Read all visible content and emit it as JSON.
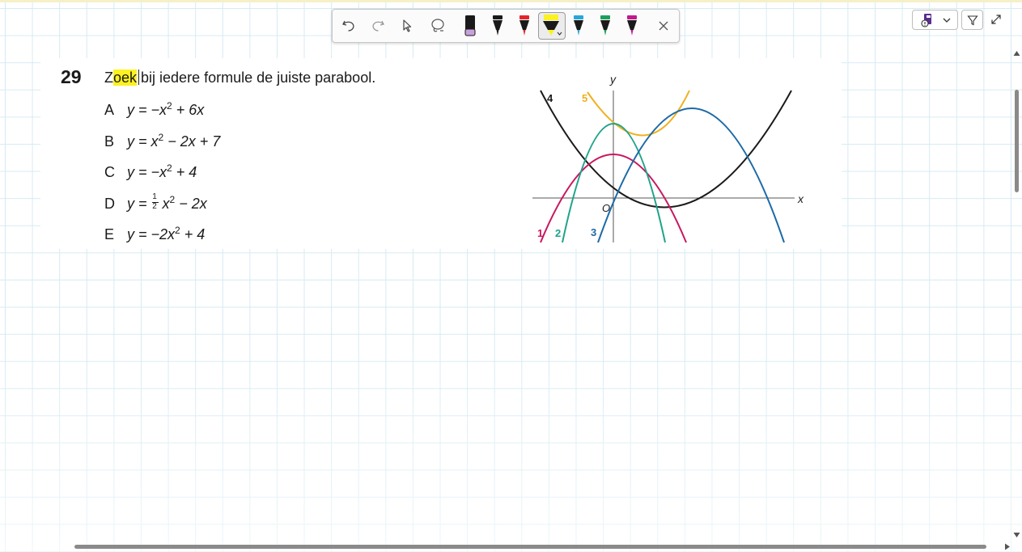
{
  "toolbar": {
    "tools": [
      {
        "name": "undo-icon"
      },
      {
        "name": "redo-icon"
      },
      {
        "name": "select-cursor-icon"
      },
      {
        "name": "lasso-icon"
      },
      {
        "name": "pen-purple-icon",
        "color": "#c9a0dc"
      },
      {
        "name": "pen-black-icon",
        "color": "#1a1a1a"
      },
      {
        "name": "pen-red-icon",
        "color": "#e3242b"
      },
      {
        "name": "highlighter-yellow-icon",
        "color": "#fbf21f",
        "selected": true
      },
      {
        "name": "pen-blue-icon",
        "color": "#2aa7d6"
      },
      {
        "name": "pen-green-icon",
        "color": "#1d9e5c"
      },
      {
        "name": "pen-magenta-icon",
        "color": "#c2188f"
      },
      {
        "name": "close-icon"
      }
    ]
  },
  "question": {
    "number": "29",
    "highlighted_word_first_letter": "Z",
    "highlighted_word_rest": "oek",
    "text_rest": "bij iedere formule de juiste parabool."
  },
  "options": [
    {
      "label": "A",
      "pre": "y = −x",
      "sup": "2",
      "post": " + 6x"
    },
    {
      "label": "B",
      "pre": "y = x",
      "sup": "2",
      "post": " − 2x + 7"
    },
    {
      "label": "C",
      "pre": "y = −x",
      "sup": "2",
      "post": " + 4"
    },
    {
      "label": "D",
      "pre": "y = ",
      "frac_num": "1",
      "frac_den": "2",
      "mid": " x",
      "sup": "2",
      "post": " − 2x"
    },
    {
      "label": "E",
      "pre": "y = −2x",
      "sup": "2",
      "post": " + 4"
    }
  ],
  "graph": {
    "x_label": "x",
    "y_label": "y",
    "origin_label": "O",
    "curves": [
      {
        "label": "1",
        "color": "#c8185f"
      },
      {
        "label": "2",
        "color": "#1fa38a"
      },
      {
        "label": "3",
        "color": "#1c6aa7"
      },
      {
        "label": "4",
        "color": "#1a1a1a"
      },
      {
        "label": "5",
        "color": "#f0b020"
      }
    ]
  },
  "colors": {
    "highlight": "#fbf21f",
    "grid": "#d6ebf3"
  }
}
